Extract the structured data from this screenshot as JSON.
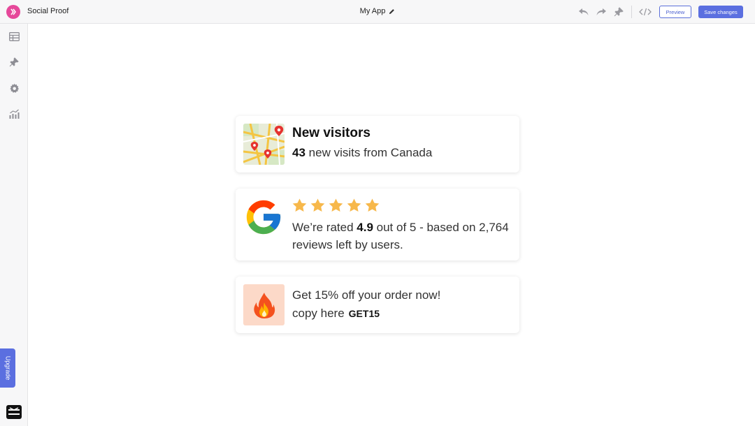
{
  "header": {
    "app_name": "Social Proof",
    "project_title": "My App",
    "preview_label": "Preview",
    "save_label": "Save changes"
  },
  "sidebar": {
    "upgrade_label": "Upgrade",
    "items": [
      "table-icon",
      "pin-icon",
      "gear-icon",
      "analytics-icon"
    ]
  },
  "cards": {
    "visitors": {
      "title": "New visitors",
      "count": "43",
      "text": "new visits from Canada"
    },
    "rating": {
      "stars": 5,
      "prefix": "We’re rated ",
      "score": "4.9",
      "suffix": " out of 5 - based on 2,764 reviews left by users."
    },
    "coupon": {
      "line1": "Get 15% off your order now!",
      "line2": "copy here",
      "code": "GET15"
    }
  },
  "colors": {
    "accent": "#5b6fe0",
    "brand": "#e6489a",
    "star": "#f7b84b",
    "coupon_bg": "#fcd9c8"
  }
}
